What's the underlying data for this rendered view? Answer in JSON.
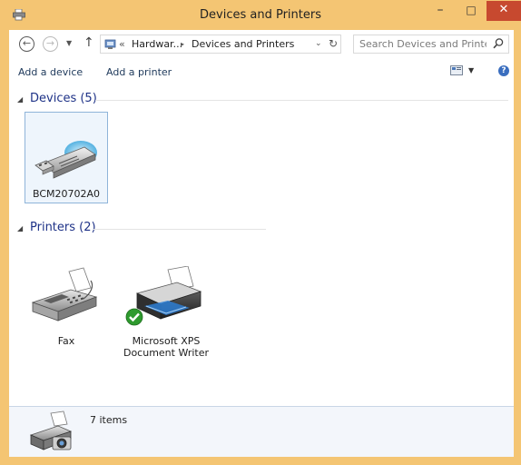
{
  "window": {
    "title": "Devices and Printers",
    "minimize_glyph": "–",
    "maximize_glyph": "□",
    "close_glyph": "✕"
  },
  "nav": {
    "back_glyph": "←",
    "forward_glyph": "→",
    "recent_glyph": "▼",
    "up_glyph": "↑",
    "breadcrumb_prefix": "«",
    "breadcrumb": [
      "Hardwar...",
      "Devices and Printers"
    ],
    "breadcrumb_separator": "▸",
    "address_dropdown_glyph": "⌄",
    "refresh_glyph": "↻",
    "search_placeholder": "Search Devices and Printers"
  },
  "commands": {
    "add_device": "Add a device",
    "add_printer": "Add a printer",
    "view_dropdown_glyph": "▼",
    "help_glyph": "?"
  },
  "groups": {
    "devices": {
      "title": "Devices (5)",
      "toggle_glyph": "◢",
      "items": [
        {
          "label": "BCM20702A0",
          "icon": "usb-device-icon"
        }
      ]
    },
    "printers": {
      "title": "Printers (2)",
      "toggle_glyph": "◢",
      "items": [
        {
          "label": "Fax",
          "icon": "fax-icon"
        },
        {
          "label": "Microsoft XPS Document Writer",
          "icon": "printer-icon",
          "default": true
        }
      ]
    }
  },
  "details": {
    "count": "7 items",
    "icon": "devices-printers-icon"
  },
  "colors": {
    "titlebar": "#f4c573",
    "close_button": "#c7492f",
    "group_title": "#1e3287",
    "selection_border": "#8fb4d9",
    "default_check": "#2e9a2e"
  }
}
